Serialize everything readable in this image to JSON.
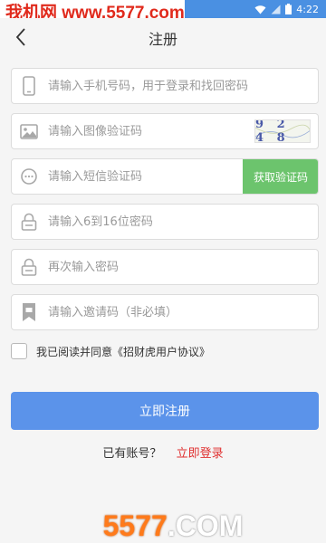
{
  "watermark": {
    "top": "我机网 www.5577.com",
    "bottom_num": "5577",
    "bottom_com": ".COM"
  },
  "status_bar": {
    "time": "4:22",
    "icons": [
      "wifi-icon",
      "signal-icon",
      "battery-icon"
    ],
    "color": "#4a90e2"
  },
  "header": {
    "title": "注册",
    "back_icon": "chevron-left-icon"
  },
  "form": {
    "phone": {
      "placeholder": "请输入手机号码，用于登录和找回密码",
      "value": "",
      "icon": "phone-icon"
    },
    "image_code": {
      "placeholder": "请输入图像验证码",
      "value": "",
      "icon": "image-icon",
      "captcha_text": "9 2 4 8"
    },
    "sms_code": {
      "placeholder": "请输入短信验证码",
      "value": "",
      "icon": "message-icon",
      "button_label": "获取验证码",
      "button_color": "#6cc46d"
    },
    "password": {
      "placeholder": "请输入6到16位密码",
      "value": "",
      "icon": "lock-icon"
    },
    "password_confirm": {
      "placeholder": "再次输入密码",
      "value": "",
      "icon": "lock-icon"
    },
    "invite_code": {
      "placeholder": "请输入邀请码（非必填）",
      "value": "",
      "icon": "bookmark-icon"
    }
  },
  "agreement": {
    "checked": false,
    "text": "我已阅读并同意《招财虎用户协议》"
  },
  "register_button": {
    "label": "立即注册",
    "color": "#5b93ea"
  },
  "login_prompt": {
    "question": "已有账号？",
    "link": "立即登录",
    "link_color": "#e03030"
  }
}
